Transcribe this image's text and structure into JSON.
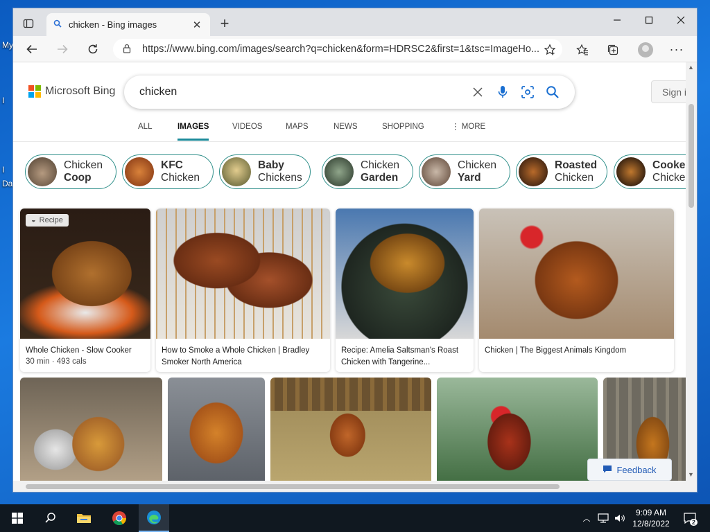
{
  "desktop": {
    "left_texts": [
      "My",
      "I",
      "I",
      "Da"
    ]
  },
  "browser": {
    "tab_title": "chicken - Bing images",
    "new_tab_symbol": "+",
    "url": "https://www.bing.com/images/search?q=chicken&form=HDRSC2&first=1&tsc=ImageHo..."
  },
  "bing": {
    "logo_text": "Microsoft Bing",
    "search_value": "chicken",
    "sign_in_label": "Sign i",
    "nav": [
      {
        "label": "ALL"
      },
      {
        "label": "IMAGES"
      },
      {
        "label": "VIDEOS"
      },
      {
        "label": "MAPS"
      },
      {
        "label": "NEWS"
      },
      {
        "label": "SHOPPING"
      },
      {
        "label": "MORE"
      }
    ],
    "related": [
      {
        "top": "Chicken",
        "bottom": "Coop",
        "bold": "bottom"
      },
      {
        "top": "KFC",
        "bottom": "Chicken",
        "bold": "top"
      },
      {
        "top": "Baby",
        "bottom": "Chickens",
        "bold": "top"
      },
      {
        "top": "Chicken",
        "bottom": "Garden",
        "bold": "bottom"
      },
      {
        "top": "Chicken",
        "bottom": "Yard",
        "bold": "bottom"
      },
      {
        "top": "Roasted",
        "bottom": "Chicken",
        "bold": "top"
      },
      {
        "top": "Cooked",
        "bottom": "Chicke",
        "bold": "top"
      }
    ],
    "results": [
      {
        "caption": "Whole Chicken - Slow Cooker",
        "sub": "30 min · 493 cals",
        "badge": "Recipe"
      },
      {
        "caption": "How to Smoke a Whole Chicken | Bradley Smoker North America"
      },
      {
        "caption": "Recipe: Amelia Saltsman's Roast Chicken with Tangerine..."
      },
      {
        "caption": "Chicken | The Biggest Animals Kingdom"
      }
    ],
    "feedback_label": "Feedback"
  },
  "taskbar": {
    "time": "9:09 AM",
    "date": "12/8/2022",
    "notifications": "2"
  },
  "colors": {
    "accent": "#1a8a9a",
    "chip_border": "#2f8f8a",
    "desktop": "#1168c8",
    "taskbar": "#101820"
  }
}
